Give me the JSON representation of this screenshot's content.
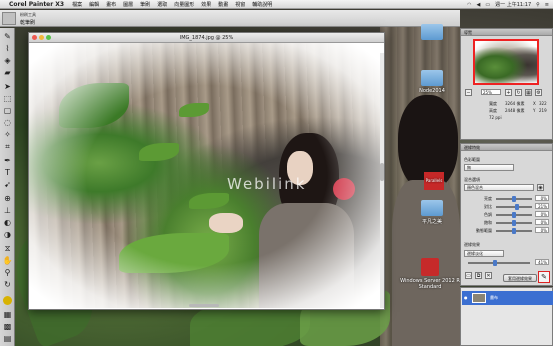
{
  "menubar": {
    "app_name": "Corel Painter X3",
    "items": [
      "檔案",
      "編輯",
      "畫布",
      "圖層",
      "筆刷",
      "選取",
      "向量圖形",
      "效果",
      "動畫",
      "視窗",
      "輔助說明"
    ],
    "clock": "週一 上午11:17"
  },
  "property_bar": {
    "brush_category": "粉刷工具",
    "brush_variant": "乾筆刷"
  },
  "document": {
    "title": "IMG_1874.jpg @ 25%",
    "watermark": "Webilink"
  },
  "desktop_icons": [
    {
      "label": "Node2014"
    },
    {
      "label": "Parallels"
    },
    {
      "label": "平凡之美"
    },
    {
      "label": "Windows Server 2012 R Standard"
    }
  ],
  "navigator": {
    "title": "導覽",
    "zoom": "25%",
    "info_labels": [
      "寬度",
      "高度",
      "X",
      "Y"
    ],
    "info_values": [
      "3264 像素",
      "2448 像素",
      "322",
      "219"
    ],
    "resolution": "72 ppi"
  },
  "effects_panel": {
    "title": "邊緣特效",
    "section1": "色彩範圍",
    "select1": "無",
    "section2": "混合選項",
    "select2": "顏色混合",
    "sliders": [
      {
        "label": "亮度",
        "value": "0%",
        "level": 0.5
      },
      {
        "label": "對比",
        "value": "21%",
        "level": 0.6
      },
      {
        "label": "色調",
        "value": "0%",
        "level": 0.5
      },
      {
        "label": "飽和",
        "value": "0%",
        "level": 0.5
      },
      {
        "label": "動態範圍",
        "value": "0%",
        "level": 0.5
      }
    ],
    "section3": "邊緣效果",
    "select3": "邊緣淡化",
    "edge_value": "41%",
    "apply_label": "套用邊緣效果"
  },
  "layers": {
    "title": "圖層",
    "layer_name": "畫布"
  }
}
